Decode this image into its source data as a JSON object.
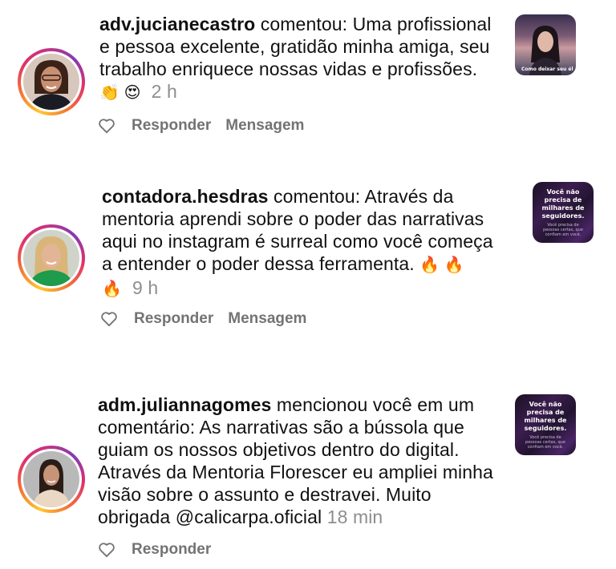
{
  "notifications": [
    {
      "username": "adv.jucianecastro",
      "action": " comentou: Uma profissional e pessoa excelente, gratidão minha amiga, seu trabalho enriquece nossas vidas e profissões. ",
      "emojis": "👏 😍",
      "time": "2 h",
      "actions": {
        "reply": "Responder",
        "message": "Mensagem"
      },
      "thumbnail": {
        "caption": "Como deixar seu él"
      }
    },
    {
      "username": "contadora.hesdras",
      "action": " comentou: Através da mentoria aprendi sobre o poder das narrativas aqui no instagram é surreal como você começa a entender o poder dessa ferramenta. ",
      "emojis": "🔥 🔥 🔥",
      "time": "9 h",
      "actions": {
        "reply": "Responder",
        "message": "Mensagem"
      },
      "thumbnail": {
        "title": "Você não precisa de milhares de seguidores.",
        "subtitle": "Você precisa de pessoas certas, que confiam em você."
      }
    },
    {
      "username": "adm.juliannagomes",
      "action": " mencionou você em um comentário: As narrativas são a bússola que guiam os nossos objetivos dentro do digital. Através da Mentoria Florescer eu ampliei minha visão sobre o assunto e destravei. Muito obrigada @calicarpa.oficial ",
      "emojis": "",
      "time": "18 min",
      "actions": {
        "reply": "Responder"
      },
      "thumbnail": {
        "title": "Você não precisa de milhares de seguidores.",
        "subtitle": "Você precisa de pessoas certas, que confiam em você."
      }
    }
  ],
  "icons": {
    "heart": "heart-outline-icon"
  },
  "colors": {
    "text": "#111111",
    "muted": "#737373",
    "time": "#8e8e8e",
    "ring_start": "#fdc830",
    "ring_mid": "#e1306c",
    "ring_end": "#833ab4"
  }
}
